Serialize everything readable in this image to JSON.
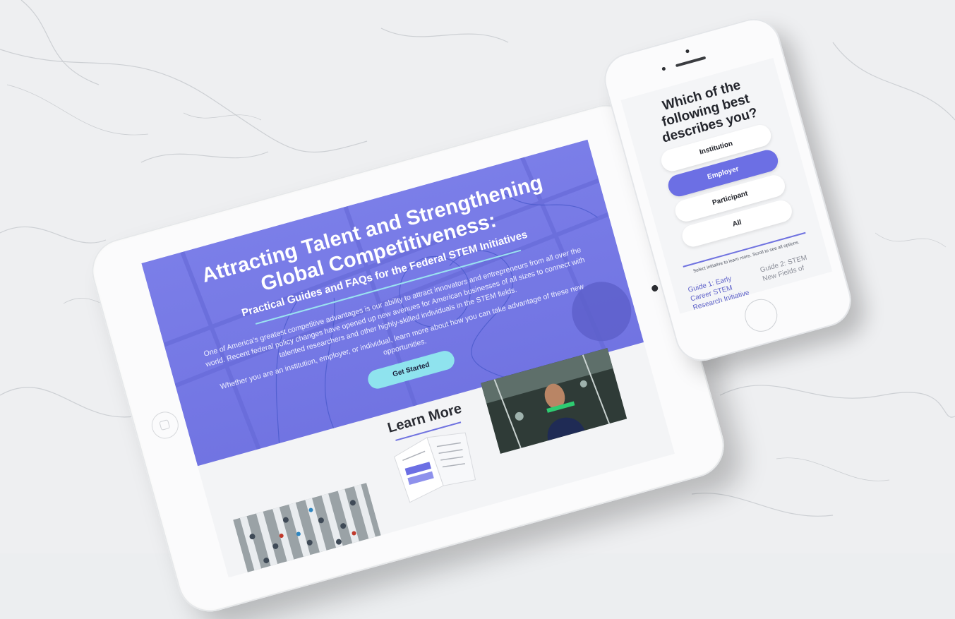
{
  "tablet": {
    "hero": {
      "title_line1": "Attracting Talent and Strengthening",
      "title_line2": "Global Competitiveness:",
      "subtitle": "Practical Guides and FAQs for the Federal STEM Initiatives",
      "body": "One of America's greatest competitive advantages is our ability to attract innovators and entrepreneurs from all over the world. Recent federal policy changes have opened up new avenues for American businesses of all sizes to connect with talented researchers and other highly-skilled individuals in the STEM fields.",
      "body2": "Whether you are an institution, employer, or individual, learn more about how you can take advantage of these new opportunities.",
      "cta_label": "Get Started"
    },
    "learn_more": {
      "title": "Learn More"
    }
  },
  "phone": {
    "question": "Which of the following best describes you?",
    "options": [
      {
        "label": "Institution"
      },
      {
        "label": "Employer"
      },
      {
        "label": "Participant"
      },
      {
        "label": "All"
      }
    ],
    "hint": "Select initiative to learn more. Scroll to see all options.",
    "guides": [
      {
        "label": "Guide 1: Early Career STEM Research Initiative"
      },
      {
        "label": "Guide 2: STEM New Fields of"
      }
    ]
  },
  "colors": {
    "accent": "#6c6fe4",
    "hero_bg": "#7679e5",
    "cta": "#8fe3ee",
    "line": "#9be3f0"
  }
}
